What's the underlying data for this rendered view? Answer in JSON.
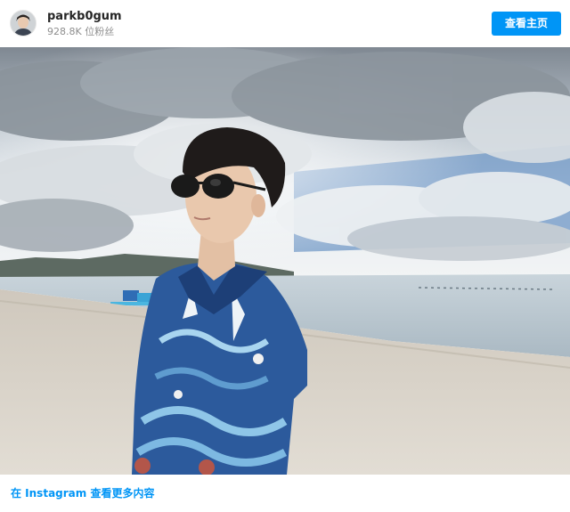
{
  "header": {
    "username": "parkb0gum",
    "followers": "928.8K 位粉丝",
    "view_profile_label": "查看主页"
  },
  "footer": {
    "link_label": "在 Instagram 查看更多内容"
  },
  "colors": {
    "accent": "#0095f6",
    "username": "#262626",
    "secondary_text": "#8e8e8e"
  }
}
